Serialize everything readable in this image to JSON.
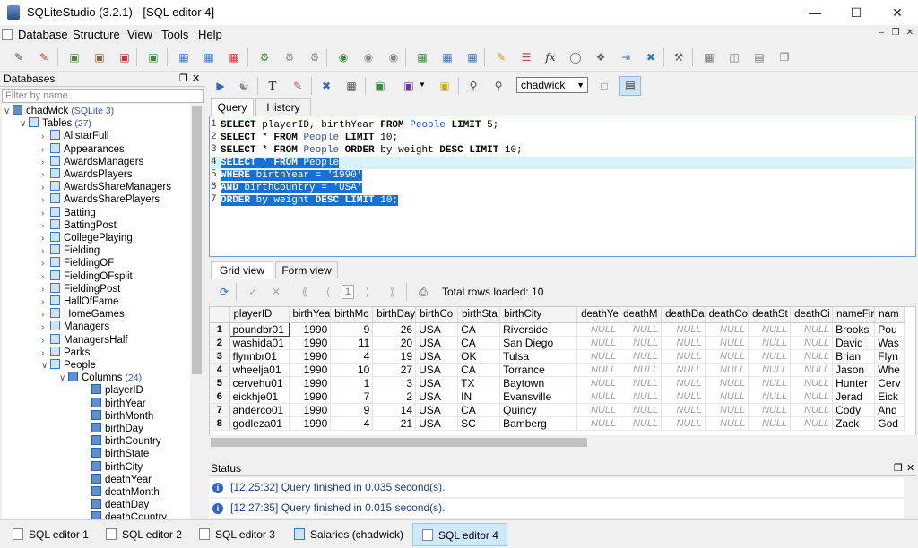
{
  "window": {
    "title": "SQLiteStudio (3.2.1) - [SQL editor 4]"
  },
  "menu": [
    "Database",
    "Structure",
    "View",
    "Tools",
    "Help"
  ],
  "db_panel": {
    "title": "Databases",
    "filter_placeholder": "Filter by name",
    "db_name": "chadwick",
    "db_type": "(SQLite 3)",
    "tables_label": "Tables",
    "tables_count": "(27)",
    "tables": [
      "AllstarFull",
      "Appearances",
      "AwardsManagers",
      "AwardsPlayers",
      "AwardsShareManagers",
      "AwardsSharePlayers",
      "Batting",
      "BattingPost",
      "CollegePlaying",
      "Fielding",
      "FieldingOF",
      "FieldingOFsplit",
      "FieldingPost",
      "HallOfFame",
      "HomeGames",
      "Managers",
      "ManagersHalf",
      "Parks",
      "People"
    ],
    "columns_label": "Columns",
    "columns_count": "(24)",
    "columns": [
      "playerID",
      "birthYear",
      "birthMonth",
      "birthDay",
      "birthCountry",
      "birthState",
      "birthCity",
      "deathYear",
      "deathMonth",
      "deathDay",
      "deathCountry"
    ]
  },
  "editor": {
    "database": "chadwick",
    "tabs": [
      "Query",
      "History"
    ],
    "line_numbers": [
      "1",
      "2",
      "3",
      "4",
      "5",
      "6",
      "7"
    ],
    "lines": [
      [
        "SELECT",
        " playerID, birthYear ",
        "FROM",
        " ",
        "People",
        " ",
        "LIMIT",
        " 5;"
      ],
      [
        "SELECT",
        " * ",
        "FROM",
        " ",
        "People",
        " ",
        "LIMIT",
        " 10;"
      ],
      [
        "SELECT",
        " * ",
        "FROM",
        " ",
        "People",
        " ",
        "ORDER",
        " by weight ",
        "DESC",
        " ",
        "LIMIT",
        " 10;"
      ],
      [
        "SELECT",
        " * ",
        "FROM",
        " ",
        "People"
      ],
      [
        "WHERE",
        " birthYear = ",
        "'1990'"
      ],
      [
        "AND",
        " birthCountry = ",
        "'USA'"
      ],
      [
        "ORDER",
        " by weight ",
        "DESC",
        " ",
        "LIMIT",
        " 10;"
      ]
    ]
  },
  "results": {
    "tabs": [
      "Grid view",
      "Form view"
    ],
    "page": "1",
    "total_rows": "Total rows loaded: 10",
    "columns": [
      "playerID",
      "birthYea",
      "birthMo",
      "birthDay",
      "birthCo",
      "birthSta",
      "birthCity",
      "deathYe",
      "deathM",
      "deathDa",
      "deathCo",
      "deathSt",
      "deathCi",
      "nameFir",
      "nam"
    ],
    "rows": [
      [
        "1",
        "poundbr01",
        "1990",
        "9",
        "26",
        "USA",
        "CA",
        "Riverside",
        "NULL",
        "NULL",
        "NULL",
        "NULL",
        "NULL",
        "NULL",
        "Brooks",
        "Pou"
      ],
      [
        "2",
        "washida01",
        "1990",
        "11",
        "20",
        "USA",
        "CA",
        "San Diego",
        "NULL",
        "NULL",
        "NULL",
        "NULL",
        "NULL",
        "NULL",
        "David",
        "Was"
      ],
      [
        "3",
        "flynnbr01",
        "1990",
        "4",
        "19",
        "USA",
        "OK",
        "Tulsa",
        "NULL",
        "NULL",
        "NULL",
        "NULL",
        "NULL",
        "NULL",
        "Brian",
        "Flyn"
      ],
      [
        "4",
        "wheelja01",
        "1990",
        "10",
        "27",
        "USA",
        "CA",
        "Torrance",
        "NULL",
        "NULL",
        "NULL",
        "NULL",
        "NULL",
        "NULL",
        "Jason",
        "Whe"
      ],
      [
        "5",
        "cervehu01",
        "1990",
        "1",
        "3",
        "USA",
        "TX",
        "Baytown",
        "NULL",
        "NULL",
        "NULL",
        "NULL",
        "NULL",
        "NULL",
        "Hunter",
        "Cerv"
      ],
      [
        "6",
        "eickhje01",
        "1990",
        "7",
        "2",
        "USA",
        "IN",
        "Evansville",
        "NULL",
        "NULL",
        "NULL",
        "NULL",
        "NULL",
        "NULL",
        "Jerad",
        "Eick"
      ],
      [
        "7",
        "anderco01",
        "1990",
        "9",
        "14",
        "USA",
        "CA",
        "Quincy",
        "NULL",
        "NULL",
        "NULL",
        "NULL",
        "NULL",
        "NULL",
        "Cody",
        "And"
      ],
      [
        "8",
        "godleza01",
        "1990",
        "4",
        "21",
        "USA",
        "SC",
        "Bamberg",
        "NULL",
        "NULL",
        "NULL",
        "NULL",
        "NULL",
        "NULL",
        "Zack",
        "God"
      ]
    ]
  },
  "status": {
    "title": "Status",
    "messages": [
      {
        "time": "[12:25:32]",
        "text": "Query finished in 0.035 second(s)."
      },
      {
        "time": "[12:27:35]",
        "text": "Query finished in 0.015 second(s)."
      }
    ]
  },
  "taskbar": [
    "SQL editor 1",
    "SQL editor 2",
    "SQL editor 3",
    "Salaries (chadwick)",
    "SQL editor 4"
  ],
  "colors": {
    "selection": "#1570d8",
    "current_line": "#d7f3f7",
    "table_name": "#2b4fbf"
  }
}
